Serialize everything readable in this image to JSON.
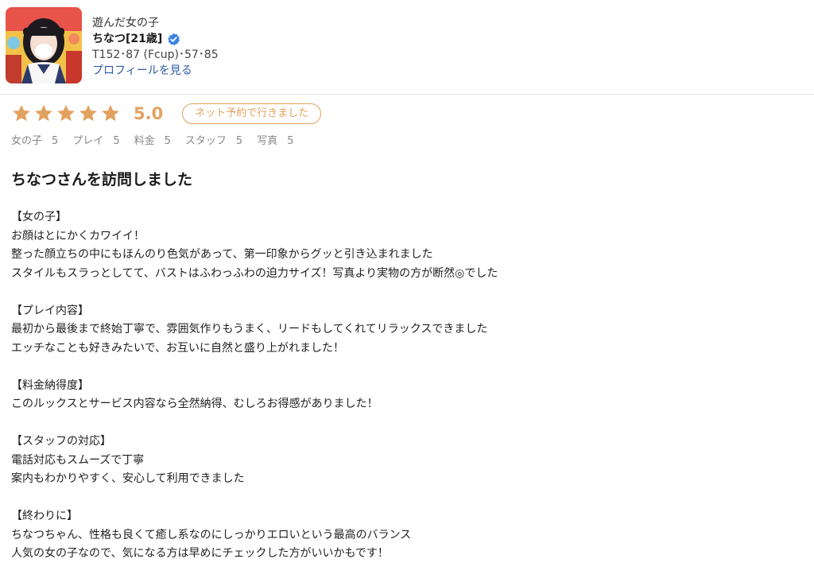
{
  "header": {
    "played_label": "遊んだ女の子",
    "name": "ちなつ[21歳]",
    "stats": "T152･87 (Fcup)･57･85",
    "profile_link": "プロフィールを見る"
  },
  "rating": {
    "stars": 5,
    "score": "5.0",
    "badge": "ネット予約で行きました",
    "star_color": "#e2a25f",
    "subscores": [
      {
        "label": "女の子",
        "value": "5"
      },
      {
        "label": "プレイ",
        "value": "5"
      },
      {
        "label": "料金",
        "value": "5"
      },
      {
        "label": "スタッフ",
        "value": "5"
      },
      {
        "label": "写真",
        "value": "5"
      }
    ]
  },
  "review": {
    "title": "ちなつさんを訪問しました",
    "sections": [
      {
        "heading": "【女の子】",
        "lines": [
          "お顔はとにかくカワイイ！",
          "整った顔立ちの中にもほんのり色気があって、第一印象からグッと引き込まれました",
          "スタイルもスラっとしてて、バストはふわっふわの迫力サイズ！写真より実物の方が断然◎でした"
        ]
      },
      {
        "heading": "【プレイ内容】",
        "lines": [
          "最初から最後まで終始丁寧で、雰囲気作りもうまく、リードもしてくれてリラックスできました",
          "エッチなことも好きみたいで、お互いに自然と盛り上がれました！"
        ]
      },
      {
        "heading": "【料金納得度】",
        "lines": [
          "このルックスとサービス内容なら全然納得、むしろお得感がありました！"
        ]
      },
      {
        "heading": "【スタッフの対応】",
        "lines": [
          "電話対応もスムーズで丁寧",
          "案内もわかりやすく、安心して利用できました"
        ]
      },
      {
        "heading": "【終わりに】",
        "lines": [
          "ちなつちゃん、性格も良くて癒し系なのにしっかりエロいという最高のバランス",
          "人気の女の子なので、気になる方は早めにチェックした方がいいかもです！"
        ]
      }
    ]
  },
  "icons": {
    "verified": "verified-check-icon",
    "star": "star-icon"
  },
  "colors": {
    "accent": "#e2a25f",
    "link": "#2f5aa6",
    "verified": "#3b82e6"
  }
}
